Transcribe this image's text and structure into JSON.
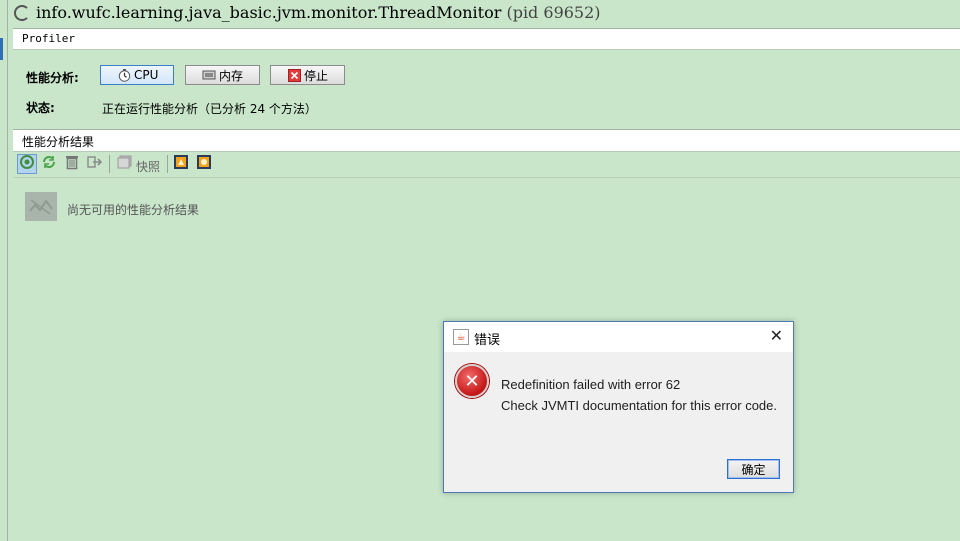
{
  "window": {
    "title": "info.wufc.learning.java_basic.jvm.monitor.ThreadMonitor",
    "pid": "(pid 69652)"
  },
  "tab": {
    "label": "Profiler"
  },
  "profiling": {
    "label": "性能分析:",
    "buttons": [
      {
        "label": "CPU",
        "icon": "clock-icon"
      },
      {
        "label": "内存",
        "icon": "memory-chip-icon"
      },
      {
        "label": "停止",
        "icon": "stop-icon"
      }
    ],
    "status_label": "状态:",
    "status_value": "正在运行性能分析（已分析 24 个方法）"
  },
  "results": {
    "header": "性能分析结果",
    "snapshot_label": "快照",
    "empty_message": "尚无可用的性能分析结果"
  },
  "dialog": {
    "title": "错误",
    "message_line1": "Redefinition failed with error 62",
    "message_line2": "Check JVMTI documentation for this error code.",
    "ok_label": "确定",
    "close_glyph": "✕",
    "error_glyph": "✕"
  },
  "colors": {
    "background": "#c9e6cb",
    "dialog_border": "#4f79b5",
    "error_red": "#c41616"
  }
}
